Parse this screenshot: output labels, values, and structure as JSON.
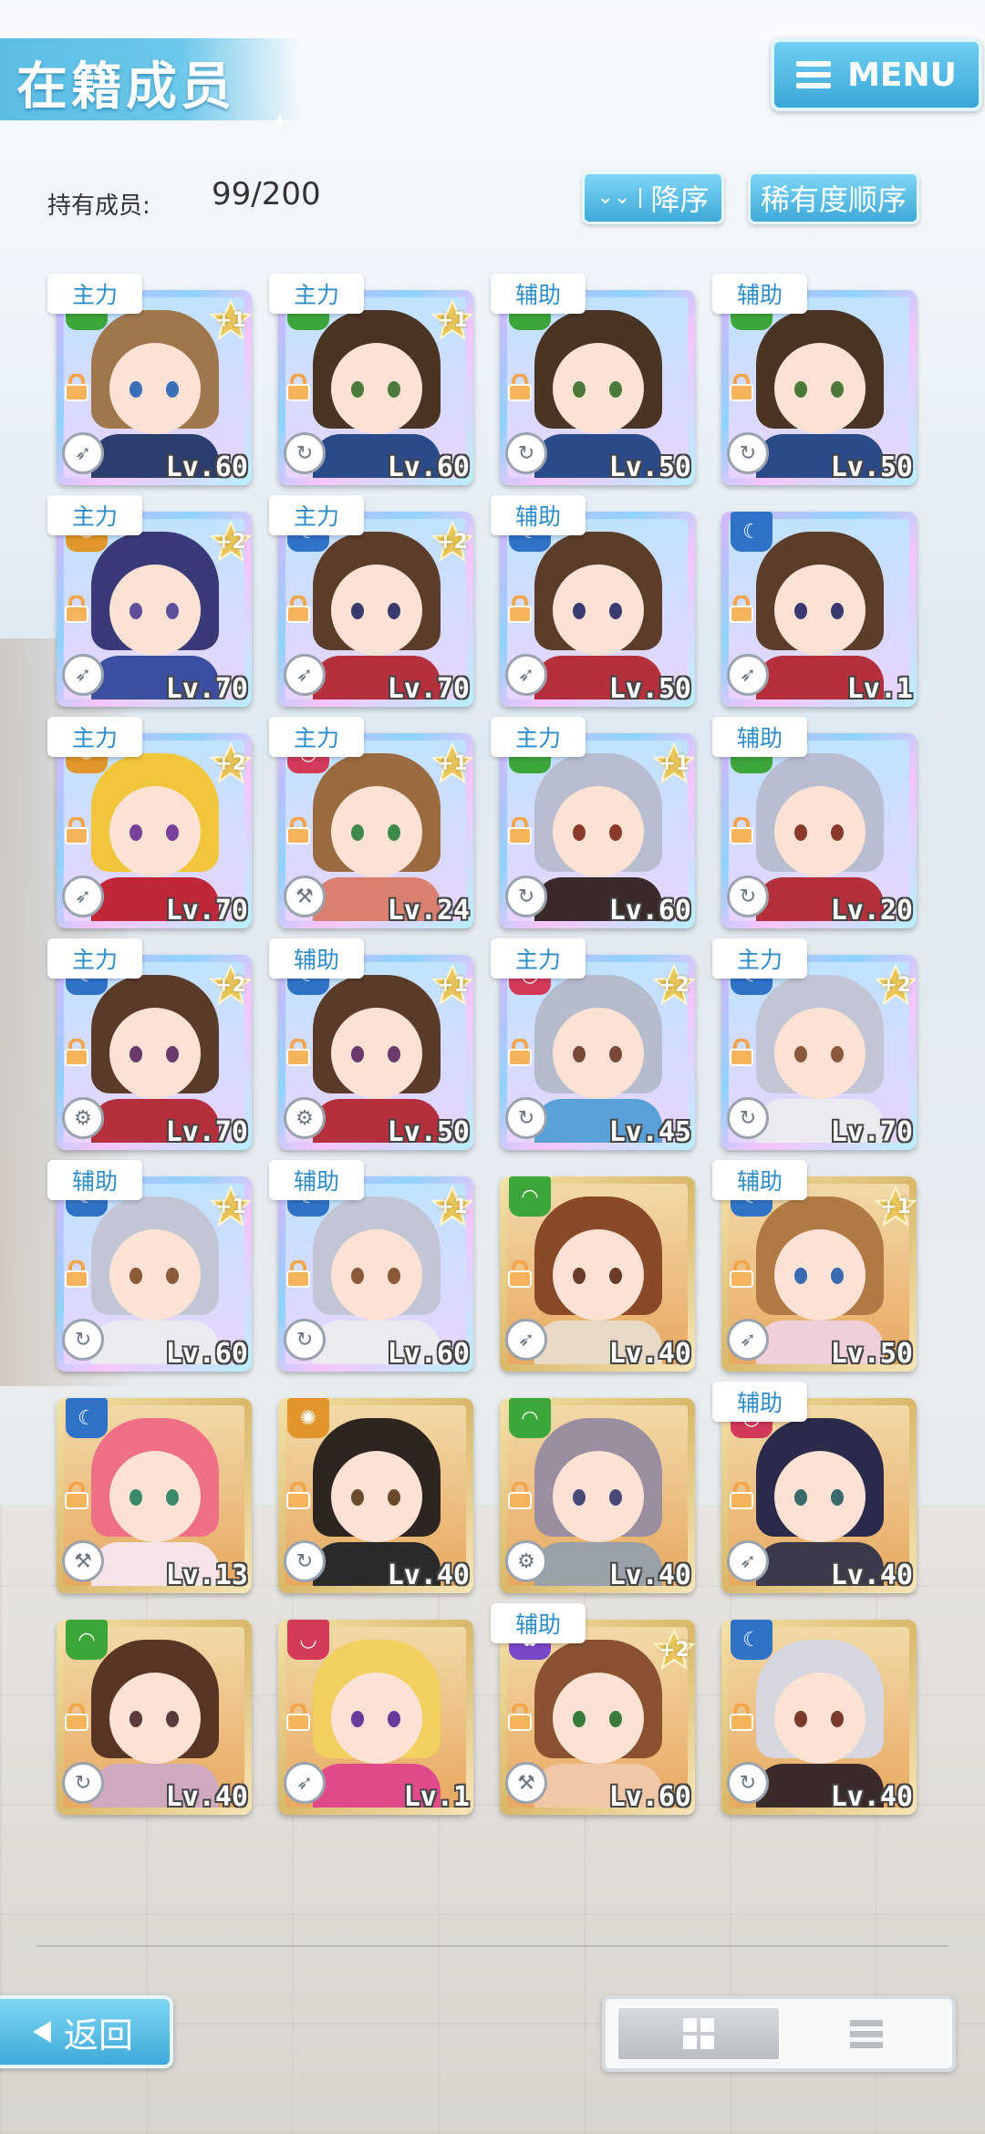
{
  "header": {
    "title": "在籍成员",
    "menu_label": "MENU"
  },
  "stats": {
    "member_count_label": "持有成员:",
    "member_count_value": "99/200"
  },
  "sort": {
    "order_label": "降序",
    "rarity_label": "稀有度顺序"
  },
  "colors": {
    "accent": "#3ea9d9",
    "role_text": "#2e8dc8",
    "attr_green": "#3da63b",
    "attr_blue": "#2f73c9",
    "attr_red": "#d33a5a",
    "attr_orange": "#e0962a",
    "attr_purple": "#7a46c8"
  },
  "cards": [
    {
      "role": "主力",
      "attr": "green",
      "plus": "+1",
      "frame": "rainbow",
      "hair": "#a0764d",
      "eye": "#3a6fb7",
      "top": "#2c3e6d",
      "level": "Lv.60",
      "type": "rocket-icon"
    },
    {
      "role": "主力",
      "attr": "green",
      "plus": "+1",
      "frame": "rainbow",
      "hair": "#4a3424",
      "eye": "#4b7a3a",
      "top": "#2b4a8a",
      "level": "Lv.60",
      "type": "swirl-icon"
    },
    {
      "role": "辅助",
      "attr": "green",
      "plus": "",
      "frame": "rainbow",
      "hair": "#4a3424",
      "eye": "#4b7a3a",
      "top": "#2b4a8a",
      "level": "Lv.50",
      "type": "swirl-icon"
    },
    {
      "role": "辅助",
      "attr": "green",
      "plus": "",
      "frame": "rainbow",
      "hair": "#4a3424",
      "eye": "#4b7a3a",
      "top": "#2b4a8a",
      "level": "Lv.50",
      "type": "swirl-icon"
    },
    {
      "role": "主力",
      "attr": "orange",
      "plus": "+2",
      "frame": "rainbow",
      "hair": "#3a3a78",
      "eye": "#5d4f9c",
      "top": "#3d4fa0",
      "level": "Lv.70",
      "type": "rocket-icon"
    },
    {
      "role": "主力",
      "attr": "blue",
      "plus": "+2",
      "frame": "rainbow",
      "hair": "#5b3d2a",
      "eye": "#3a3a70",
      "top": "#b3303c",
      "level": "Lv.70",
      "type": "rocket-icon"
    },
    {
      "role": "辅助",
      "attr": "blue",
      "plus": "",
      "frame": "rainbow",
      "hair": "#5b3d2a",
      "eye": "#3a3a70",
      "top": "#b3303c",
      "level": "Lv.50",
      "type": "rocket-icon"
    },
    {
      "role": "",
      "attr": "blue",
      "plus": "",
      "frame": "rainbow",
      "hair": "#5b3d2a",
      "eye": "#3a3a70",
      "top": "#b3303c",
      "level": "Lv.1",
      "type": "rocket-icon"
    },
    {
      "role": "主力",
      "attr": "orange",
      "plus": "+2",
      "frame": "rainbow",
      "hair": "#f2c63a",
      "eye": "#7a3f9a",
      "top": "#c0283a",
      "level": "Lv.70",
      "type": "rocket-icon"
    },
    {
      "role": "主力",
      "attr": "red",
      "plus": "+1",
      "frame": "rainbow",
      "hair": "#9a6a40",
      "eye": "#3f8a4a",
      "top": "#d98070",
      "level": "Lv.24",
      "type": "hammer-icon"
    },
    {
      "role": "主力",
      "attr": "green",
      "plus": "+1",
      "frame": "rainbow",
      "hair": "#b9bdd0",
      "eye": "#8a3a2a",
      "top": "#3a2a2a",
      "level": "Lv.60",
      "type": "swirl-icon"
    },
    {
      "role": "辅助",
      "attr": "green",
      "plus": "",
      "frame": "rainbow",
      "hair": "#b9bdd0",
      "eye": "#8a3a2a",
      "top": "#b3303c",
      "level": "Lv.20",
      "type": "swirl-icon"
    },
    {
      "role": "主力",
      "attr": "blue",
      "plus": "+2",
      "frame": "rainbow",
      "hair": "#5a3a28",
      "eye": "#6a3a6a",
      "top": "#b3303c",
      "level": "Lv.70",
      "type": "gear-icon"
    },
    {
      "role": "辅助",
      "attr": "blue",
      "plus": "+1",
      "frame": "rainbow",
      "hair": "#5a3a28",
      "eye": "#6a3a6a",
      "top": "#b3303c",
      "level": "Lv.50",
      "type": "gear-icon"
    },
    {
      "role": "主力",
      "attr": "red",
      "plus": "+2",
      "frame": "rainbow",
      "hair": "#b5bccc",
      "eye": "#7a4a3a",
      "top": "#5aa0d8",
      "level": "Lv.45",
      "type": "swirl-icon"
    },
    {
      "role": "主力",
      "attr": "blue",
      "plus": "+2",
      "frame": "rainbow",
      "hair": "#c2c6d4",
      "eye": "#8a5a3a",
      "top": "#eaeaf0",
      "level": "Lv.70",
      "type": "swirl-icon"
    },
    {
      "role": "辅助",
      "attr": "blue",
      "plus": "+1",
      "frame": "rainbow",
      "hair": "#c2c6d4",
      "eye": "#8a5a3a",
      "top": "#eaeaf0",
      "level": "Lv.60",
      "type": "swirl-icon"
    },
    {
      "role": "辅助",
      "attr": "blue",
      "plus": "+1",
      "frame": "rainbow",
      "hair": "#c2c6d4",
      "eye": "#8a5a3a",
      "top": "#eaeaf0",
      "level": "Lv.60",
      "type": "swirl-icon"
    },
    {
      "role": "",
      "attr": "green",
      "plus": "",
      "frame": "gold",
      "hair": "#8a4a2a",
      "eye": "#6a3a2a",
      "top": "#e8d9c7",
      "level": "Lv.40",
      "type": "rocket-icon"
    },
    {
      "role": "辅助",
      "attr": "blue",
      "plus": "+1",
      "frame": "gold",
      "hair": "#b07a45",
      "eye": "#3a6ab0",
      "top": "#f0d0d8",
      "level": "Lv.50",
      "type": "rocket-icon"
    },
    {
      "role": "",
      "attr": "blue",
      "plus": "",
      "frame": "gold",
      "hair": "#ef6f86",
      "eye": "#3a8a6a",
      "top": "#f4e4ea",
      "level": "Lv.13",
      "type": "hammer-icon"
    },
    {
      "role": "",
      "attr": "orange",
      "plus": "",
      "frame": "gold",
      "hair": "#2e2420",
      "eye": "#6a4a2a",
      "top": "#2a2a2a",
      "level": "Lv.40",
      "type": "swirl-icon"
    },
    {
      "role": "",
      "attr": "green",
      "plus": "",
      "frame": "gold",
      "hair": "#9a8ea0",
      "eye": "#4a4a7a",
      "top": "#9aa0a8",
      "level": "Lv.40",
      "type": "gear-icon"
    },
    {
      "role": "辅助",
      "attr": "red",
      "plus": "",
      "frame": "gold",
      "hair": "#2a2a4a",
      "eye": "#3a6a6a",
      "top": "#3a3a4a",
      "level": "Lv.40",
      "type": "rocket-icon"
    },
    {
      "role": "",
      "attr": "green",
      "plus": "",
      "frame": "gold",
      "hair": "#5a3424",
      "eye": "#5a3a3a",
      "top": "#d0a8c0",
      "level": "Lv.40",
      "type": "swirl-icon"
    },
    {
      "role": "",
      "attr": "red",
      "plus": "",
      "frame": "gold",
      "hair": "#f2d060",
      "eye": "#6a3a9a",
      "top": "#e04a8a",
      "level": "Lv.1",
      "type": "rocket-icon"
    },
    {
      "role": "辅助",
      "attr": "purple",
      "plus": "+2",
      "frame": "gold",
      "hair": "#8a5230",
      "eye": "#3a7a3a",
      "top": "#f0c8a8",
      "level": "Lv.60",
      "type": "hammer-icon"
    },
    {
      "role": "",
      "attr": "blue",
      "plus": "",
      "frame": "gold",
      "hair": "#d6d6e0",
      "eye": "#7a3a2a",
      "top": "#3a2a2a",
      "level": "Lv.40",
      "type": "swirl-icon"
    }
  ],
  "footer": {
    "back_label": "返回"
  }
}
